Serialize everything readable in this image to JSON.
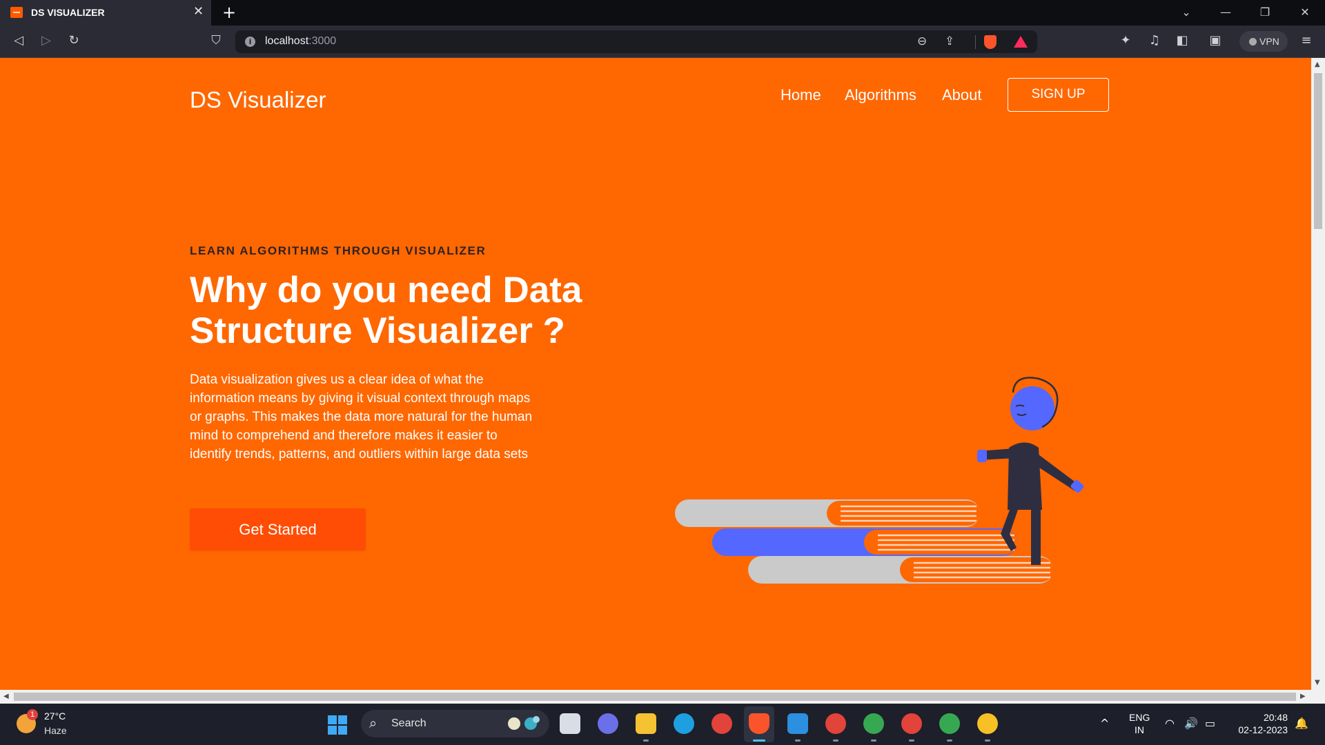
{
  "browser": {
    "tab_title": "DS VISUALIZER",
    "url_host": "localhost",
    "url_port": ":3000",
    "vpn_label": "VPN",
    "icons": [
      "back-icon",
      "forward-icon",
      "reload-icon",
      "bookmark-icon",
      "zoom-icon",
      "share-icon",
      "brave-shields-icon",
      "brave-rewards-icon",
      "extensions-icon",
      "media-icon",
      "sidebar-icon",
      "wallet-icon",
      "menu-icon"
    ]
  },
  "site": {
    "brand": "DS Visualizer",
    "nav": [
      {
        "label": "Home"
      },
      {
        "label": "Algorithms"
      },
      {
        "label": "About"
      }
    ],
    "signup_label": "SIGN UP",
    "hero": {
      "eyebrow": "LEARN ALGORITHMS THROUGH VISUALIZER",
      "headline": "Why do you need Data Structure Visualizer ?",
      "description": "Data visualization gives us a clear idea of what the information means by giving it visual context through maps or graphs. This makes the data more natural for the human mind to comprehend and therefore makes it easier to identify trends, patterns, and outliers within large data sets",
      "cta_label": "Get Started"
    },
    "colors": {
      "background": "#ff6700",
      "cta": "#ff4d05",
      "figure_blue": "#5468ff",
      "figure_dark": "#2f2e41",
      "book_gray": "#cacaca"
    }
  },
  "taskbar": {
    "weather_temp": "27°C",
    "weather_cond": "Haze",
    "weather_badge": "1",
    "search_placeholder": "Search",
    "lang_line1": "ENG",
    "lang_line2": "IN",
    "time": "20:48",
    "date": "02-12-2023"
  }
}
